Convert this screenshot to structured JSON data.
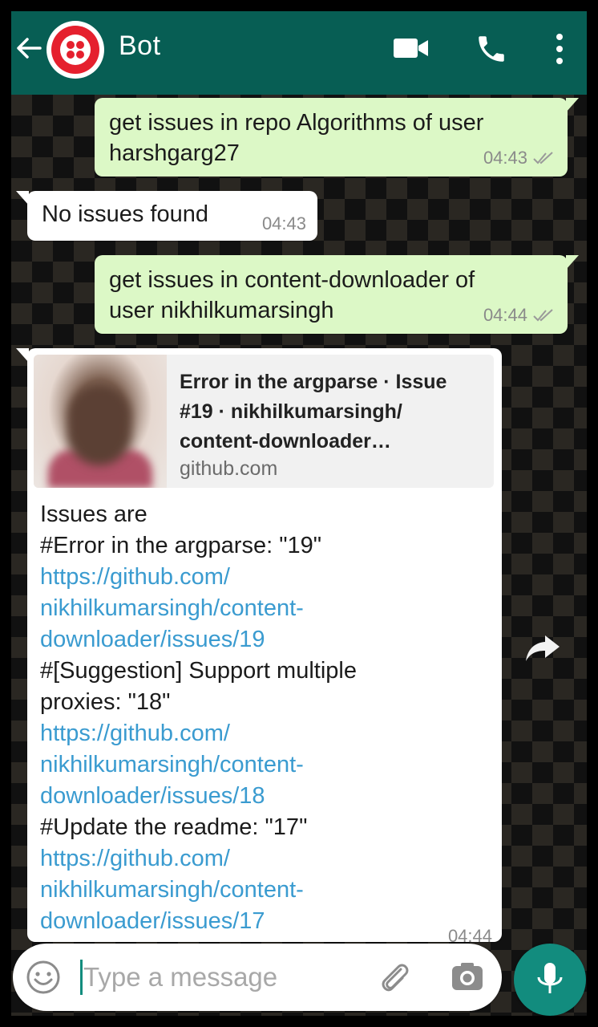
{
  "header": {
    "title": "Bot",
    "back_icon": "arrow-left-icon",
    "avatar_icon": "twilio-logo",
    "actions": [
      "video-call-icon",
      "phone-icon",
      "more-vert-icon"
    ],
    "background": "#075e54"
  },
  "messages": [
    {
      "direction": "outgoing",
      "lines": [
        "get issues in repo Algorithms of user",
        "harshgarg27"
      ],
      "time": "04:43",
      "status": "read-check-icon"
    },
    {
      "direction": "incoming",
      "lines": [
        "No issues found"
      ],
      "time": "04:43"
    },
    {
      "direction": "outgoing",
      "lines": [
        "get issues in content-downloader of",
        "user nikhilkumarsingh"
      ],
      "time": "04:44",
      "status": "read-check-icon"
    },
    {
      "direction": "incoming",
      "link_preview": {
        "title_lines": [
          "Error in the argparse · Issue",
          "#19 · nikhilkumarsingh/",
          "content-downloader…"
        ],
        "domain": "github.com"
      },
      "lines": [
        "Issues are",
        "#Error in the argparse: \"19\"",
        " https://github.com/",
        "nikhilkumarsingh/content-",
        "downloader/issues/19",
        "#[Suggestion] Support multiple",
        "proxies: \"18\"",
        " https://github.com/",
        "nikhilkumarsingh/content-",
        "downloader/issues/18",
        "#Update the readme: \"17\"",
        " https://github.com/",
        "nikhilkumarsingh/content-",
        "downloader/issues/17"
      ],
      "time": "04:44"
    }
  ],
  "composer": {
    "placeholder": "Type a message",
    "emoji_icon": "emoji-icon",
    "attach_icon": "paperclip-icon",
    "camera_icon": "camera-icon",
    "mic_icon": "microphone-icon"
  },
  "colors": {
    "outgoing_bubble": "#dcf8c6",
    "incoming_bubble": "#ffffff",
    "link": "#3a9bd0",
    "accent": "#128c7e"
  }
}
